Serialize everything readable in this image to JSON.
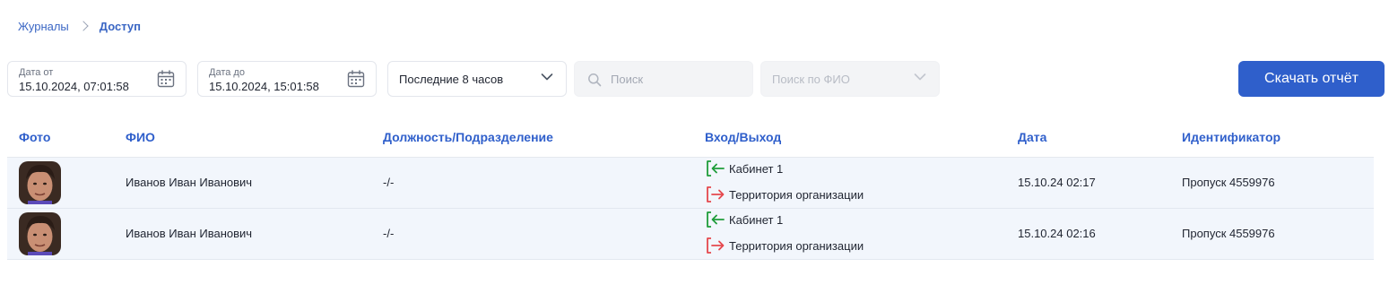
{
  "breadcrumb": {
    "parent": "Журналы",
    "current": "Доступ"
  },
  "filters": {
    "date_from": {
      "label": "Дата от",
      "value": "15.10.2024, 07:01:58"
    },
    "date_to": {
      "label": "Дата до",
      "value": "15.10.2024, 15:01:58"
    },
    "period": {
      "value": "Последние 8 часов"
    },
    "search": {
      "placeholder": "Поиск",
      "value": ""
    },
    "fio": {
      "placeholder": "Поиск по ФИО",
      "value": ""
    },
    "download_label": "Скачать отчёт"
  },
  "table": {
    "columns": {
      "photo": "Фото",
      "fio": "ФИО",
      "position": "Должность/Подразделение",
      "passage": "Вход/Выход",
      "date": "Дата",
      "identifier": "Идентификатор"
    },
    "rows": [
      {
        "fio": "Иванов Иван Иванович",
        "position": "-/-",
        "entry": "Кабинет 1",
        "exit": "Территория организации",
        "date": "15.10.24 02:17",
        "identifier": "Пропуск 4559976"
      },
      {
        "fio": "Иванов Иван Иванович",
        "position": "-/-",
        "entry": "Кабинет 1",
        "exit": "Территория организации",
        "date": "15.10.24 02:16",
        "identifier": "Пропуск 4559976"
      }
    ]
  },
  "colors": {
    "accent": "#2f5fcb",
    "entry": "#1f9d3a",
    "exit": "#e5484d",
    "row_bg": "#f2f6fc"
  },
  "icons": {
    "calendar": "calendar-icon",
    "chevron": "chevron-down-icon",
    "search": "search-icon",
    "entry": "entry-arrow-icon",
    "exit": "exit-arrow-icon",
    "avatar": "avatar"
  }
}
